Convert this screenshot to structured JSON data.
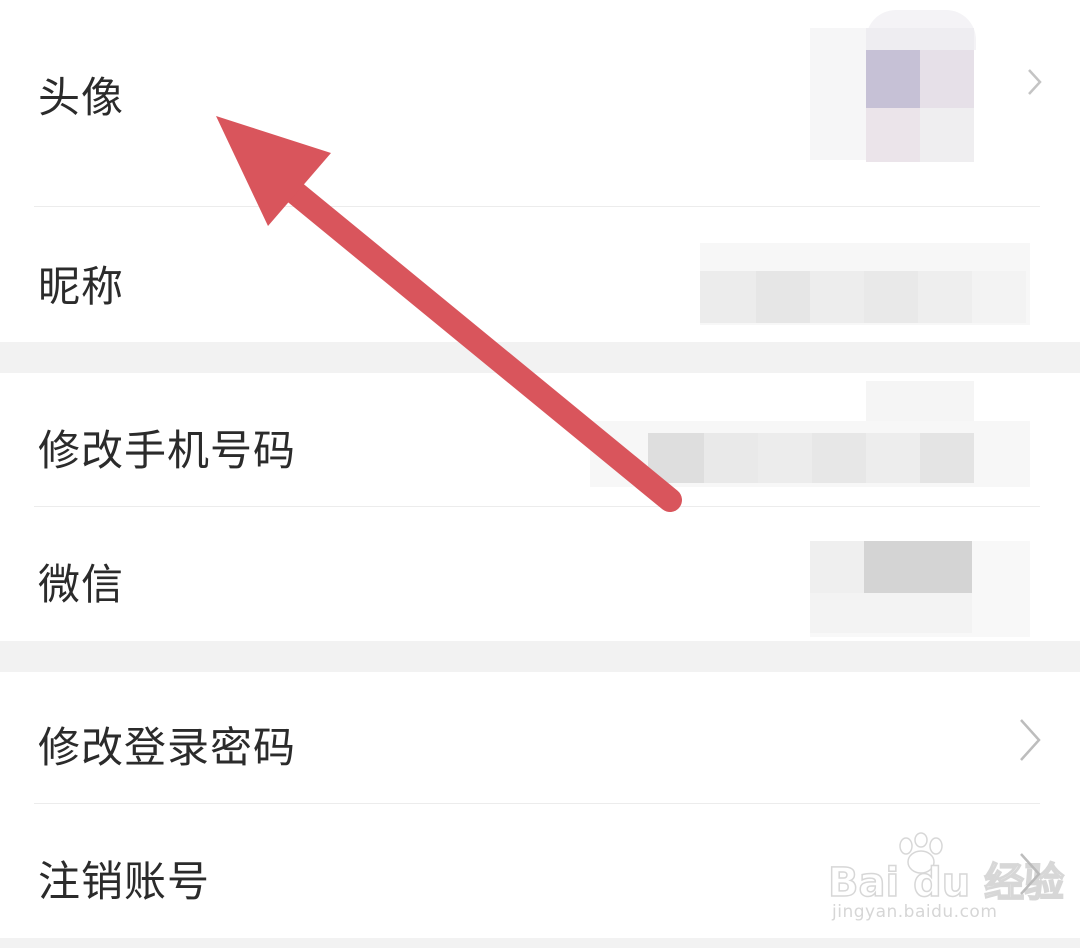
{
  "rows": {
    "avatar": {
      "label": "头像"
    },
    "nickname": {
      "label": "昵称"
    },
    "change_phone": {
      "label": "修改手机号码"
    },
    "wechat": {
      "label": "微信"
    },
    "change_password": {
      "label": "修改登录密码"
    },
    "cancel_account": {
      "label": "注销账号"
    }
  },
  "watermark": {
    "brand": "Bai du 经验",
    "url": "jingyan.baidu.com"
  },
  "annotation": {
    "arrow_color": "#d9555c"
  },
  "icons": {
    "chevron": "chevron-right-icon",
    "paw": "paw-icon"
  }
}
